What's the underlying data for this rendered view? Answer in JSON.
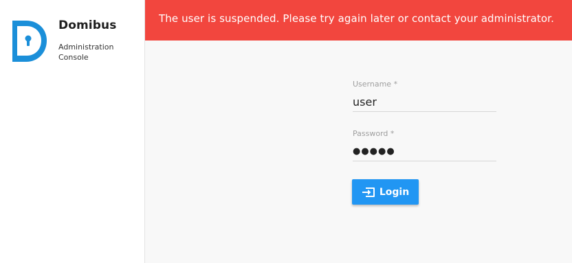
{
  "app": {
    "title": "Domibus",
    "subtitle": "Administration Console",
    "logo_icon": "domibus-lock-logo",
    "brand_color": "#1b8fd9"
  },
  "alert": {
    "message": "The user is suspended. Please try again later or contact your administrator.",
    "color": "#f2463e"
  },
  "form": {
    "username": {
      "label": "Username *",
      "value": "user"
    },
    "password": {
      "label": "Password *",
      "value": "●●●●●"
    },
    "login_button": {
      "label": "Login",
      "icon": "login-icon",
      "color": "#2196f3"
    }
  }
}
